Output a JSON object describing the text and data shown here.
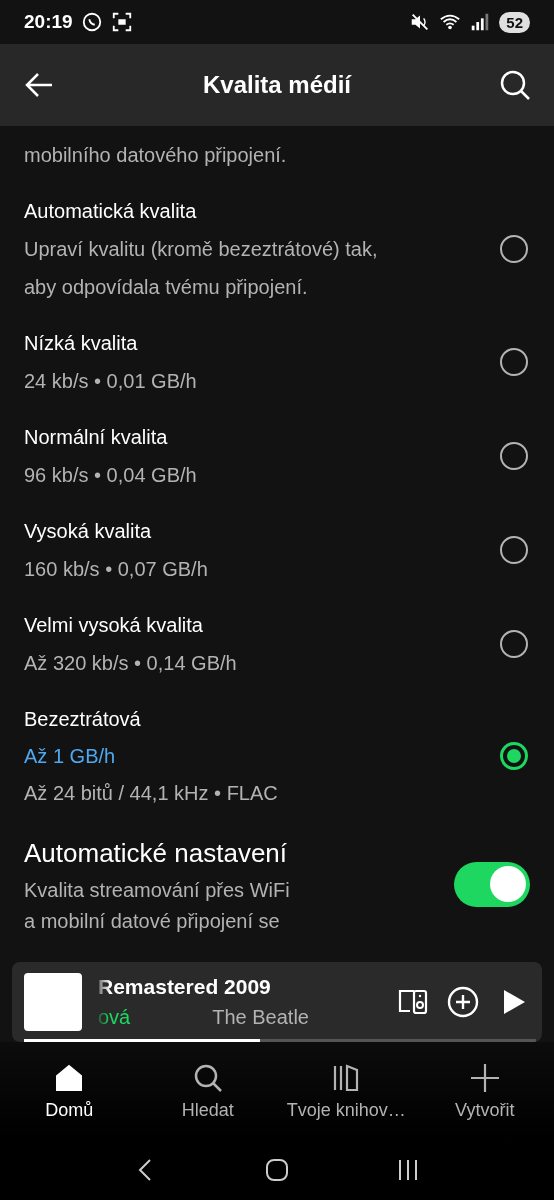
{
  "status_bar": {
    "time": "20:19",
    "battery": "52"
  },
  "header": {
    "title": "Kvalita médií"
  },
  "intro": "mobilního datového připojení.",
  "options": [
    {
      "title": "Automatická kvalita",
      "lines": [
        "Upraví kvalitu (kromě bezeztrátové) tak,",
        "aby odpovídala tvému připojení."
      ],
      "selected": false
    },
    {
      "title": "Nízká kvalita",
      "lines": [
        "24 kb/s • 0,01 GB/h"
      ],
      "selected": false
    },
    {
      "title": "Normální kvalita",
      "lines": [
        "96 kb/s • 0,04 GB/h"
      ],
      "selected": false
    },
    {
      "title": "Vysoká kvalita",
      "lines": [
        "160 kb/s • 0,07 GB/h"
      ],
      "selected": false
    },
    {
      "title": "Velmi vysoká kvalita",
      "lines": [
        "Až 320 kb/s • 0,14 GB/h"
      ],
      "selected": false
    },
    {
      "title": "Bezeztrátová",
      "highlight": "Až 1 GB/h",
      "lines": [
        "Až 24 bitů / 44,1 kHz • FLAC"
      ],
      "selected": true
    }
  ],
  "auto_setting": {
    "title": "Automatické nastavení",
    "lines": [
      "Kvalita streamování přes WiFi",
      "a mobilní datové připojení se"
    ],
    "on": true
  },
  "mini_player": {
    "title": "Remastered 2009",
    "subtitle": "ová",
    "artist": "The Beatle",
    "level": 0.46
  },
  "nav": [
    {
      "label": "Domů",
      "selected": true
    },
    {
      "label": "Hledat",
      "selected": false
    },
    {
      "label": "Tvoje knihov…",
      "selected": false
    },
    {
      "label": "Vytvořit",
      "selected": false
    }
  ]
}
